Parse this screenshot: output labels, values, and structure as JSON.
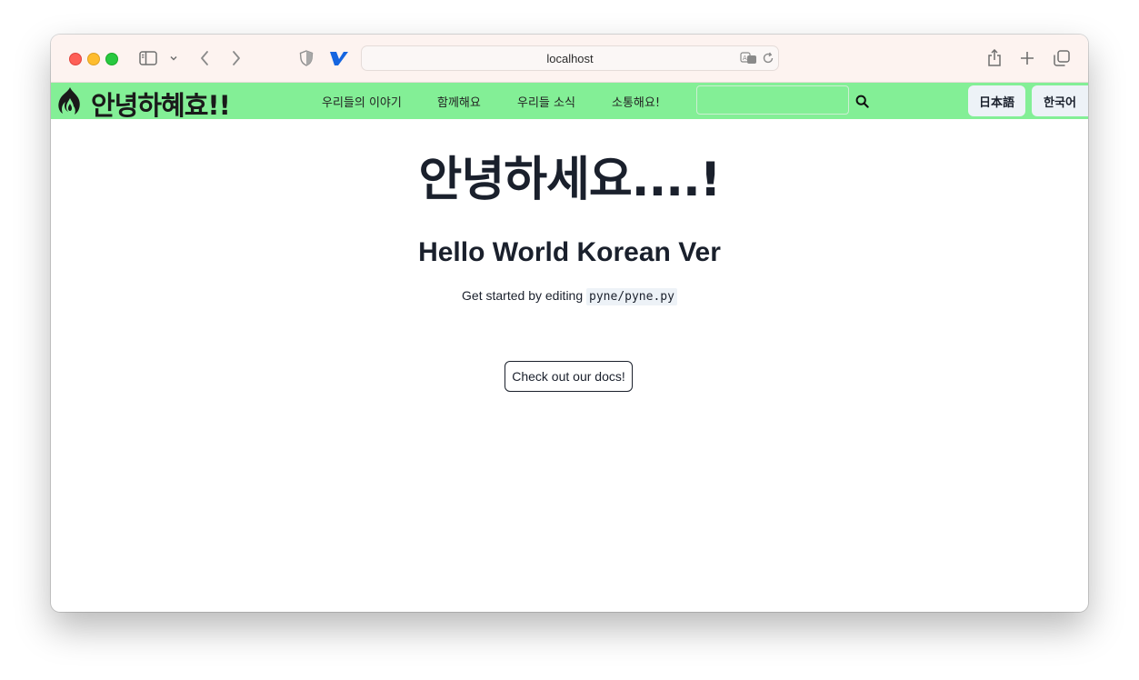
{
  "browser": {
    "url": "localhost",
    "icons": [
      "sidebar-icon",
      "chevron-down-icon",
      "back-icon",
      "forward-icon",
      "privacy-shield-icon",
      "vivaldi-v-icon",
      "translate-icon",
      "reload-icon",
      "share-icon",
      "new-tab-plus-icon",
      "tab-overview-icon"
    ]
  },
  "navbar": {
    "brand": "안녕하혜효!!",
    "links": [
      "우리들의 이야기",
      "함께해요",
      "우리들 소식",
      "소통해요!"
    ],
    "search_value": "",
    "languages": [
      "日本語",
      "한국어"
    ],
    "background": "#83ef96"
  },
  "main": {
    "heading": "안녕하세요....!",
    "subheading": "Hello World Korean Ver",
    "subtitle_prefix": "Get started by editing",
    "subtitle_code": "pyne/pyne.py",
    "docs_button": "Check out our docs!"
  }
}
